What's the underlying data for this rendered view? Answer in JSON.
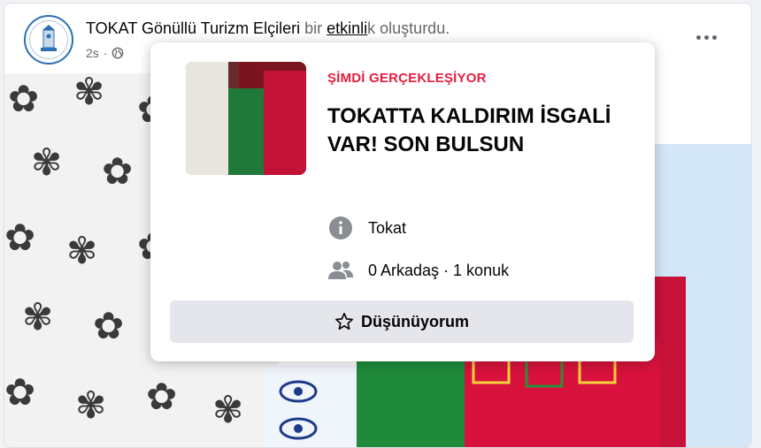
{
  "post": {
    "page_name": "TOKAT Gönüllü Turizm Elçileri",
    "action_prefix": "bir",
    "action_link": "etkinli",
    "action_suffix": "k oluşturdu.",
    "time": "2s",
    "separator": "·",
    "privacy_icon": "globe-icon",
    "more_icon": "more-options-icon"
  },
  "event": {
    "status": "ŞİMDİ GERÇEKLEŞİYOR",
    "title": "TOKATTA KALDIRIM İSGALİ VAR! SON BULSUN",
    "location_icon": "info-icon",
    "location": "Tokat",
    "guests_icon": "people-icon",
    "guests": "0 Arkadaş · 1 konuk",
    "button_icon": "star-icon",
    "button_label": "Düşünüyorum"
  },
  "colors": {
    "status": "#e41e3f",
    "button_bg": "#e4e6eb",
    "muted_text": "#65676b"
  }
}
